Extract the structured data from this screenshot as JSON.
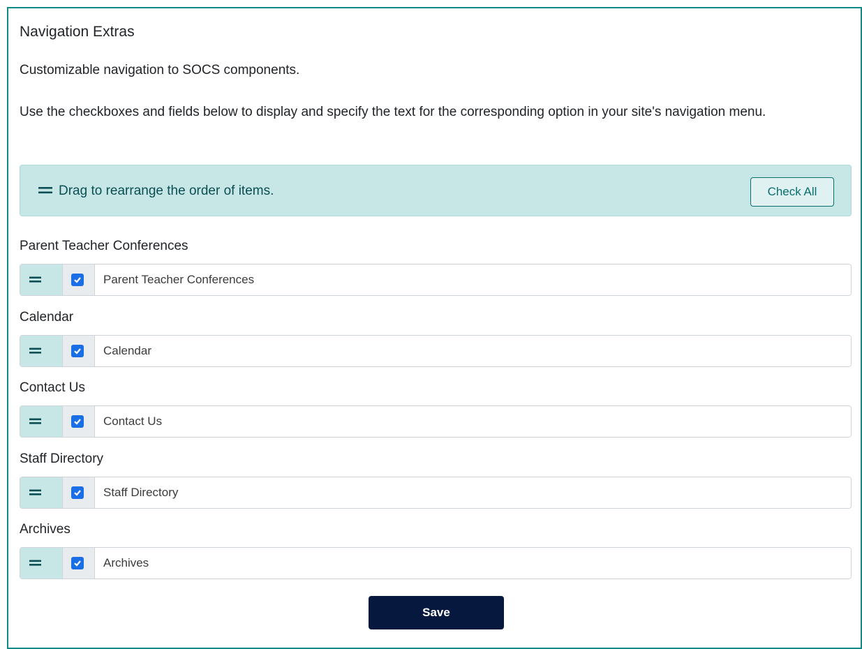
{
  "heading": "Navigation Extras",
  "intro": "Customizable navigation to SOCS components.",
  "description": "Use the checkboxes and fields below to display and specify the text for the corresponding option in your site's navigation menu.",
  "info_bar": {
    "icon": "drag-handle-icon",
    "text": "Drag to rearrange the order of items.",
    "check_all_label": "Check All"
  },
  "items": [
    {
      "label": "Parent Teacher Conferences",
      "value": "Parent Teacher Conferences",
      "checked": true
    },
    {
      "label": "Calendar",
      "value": "Calendar",
      "checked": true
    },
    {
      "label": "Contact Us",
      "value": "Contact Us",
      "checked": true
    },
    {
      "label": "Staff Directory",
      "value": "Staff Directory",
      "checked": true
    },
    {
      "label": "Archives",
      "value": "Archives",
      "checked": true
    }
  ],
  "save_label": "Save",
  "colors": {
    "panel_border": "#0f8a86",
    "info_bg": "#c7e6e6",
    "accent_text": "#0b6e6e",
    "checkbox": "#1a6fe6",
    "save_bg": "#06183e"
  }
}
